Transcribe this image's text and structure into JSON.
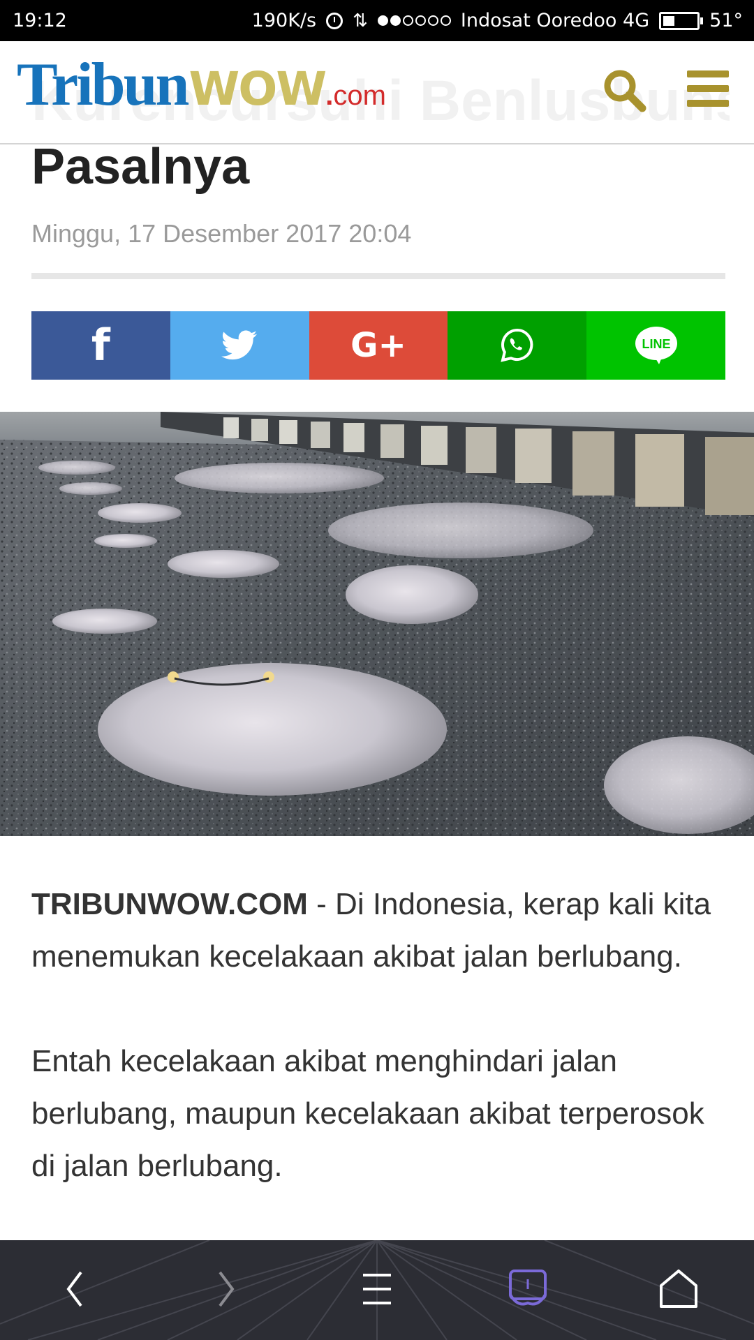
{
  "status_bar": {
    "time": "19:12",
    "net_speed": "190K/s",
    "carrier": "Indosat Ooredoo 4G",
    "temperature": "51°",
    "signal_bars_filled": 2,
    "signal_bars_total": 6,
    "battery_level": 0.35
  },
  "header": {
    "logo_tribun": "Tribun",
    "logo_wow": "WOW",
    "logo_dot": ".",
    "logo_com": "com",
    "ghost_title": "Kurencursuhi Benlusbuns Kasa Minta Ganti Rugi, Ada",
    "icons": [
      "search-icon",
      "menu-icon"
    ]
  },
  "article": {
    "title_tail": "Pasalnya",
    "date": "Minggu, 17 Desember 2017 20:04",
    "share": {
      "facebook_icon": "facebook-icon",
      "twitter_icon": "twitter-icon",
      "googleplus_icon": "google-plus-icon",
      "googleplus_glyph": "G+",
      "whatsapp_icon": "whatsapp-icon",
      "line_icon": "line-icon",
      "line_label": "LINE",
      "facebook_glyph": "f"
    },
    "source": "TRIBUNWOW.COM",
    "para1_rest": " - Di Indonesia, kerap kali kita menemukan kecelakaan akibat jalan berlubang.",
    "para2": "Entah kecelakaan akibat menghindari jalan berlubang, maupun kecelakaan akibat terperosok di jalan berlubang."
  },
  "colors": {
    "tribun_blue": "#1773bb",
    "wow_gold": "#cdbf63",
    "header_icon_gold": "#a8922d",
    "com_red": "#d32b2b",
    "facebook": "#3b5998",
    "twitter": "#55acee",
    "googleplus": "#dd4b39",
    "whatsapp": "#00a000",
    "line": "#00c300"
  },
  "nav_bar": {
    "icons": [
      "back-icon",
      "forward-icon",
      "menu-lines-icon",
      "tabs-icon",
      "home-icon"
    ]
  }
}
